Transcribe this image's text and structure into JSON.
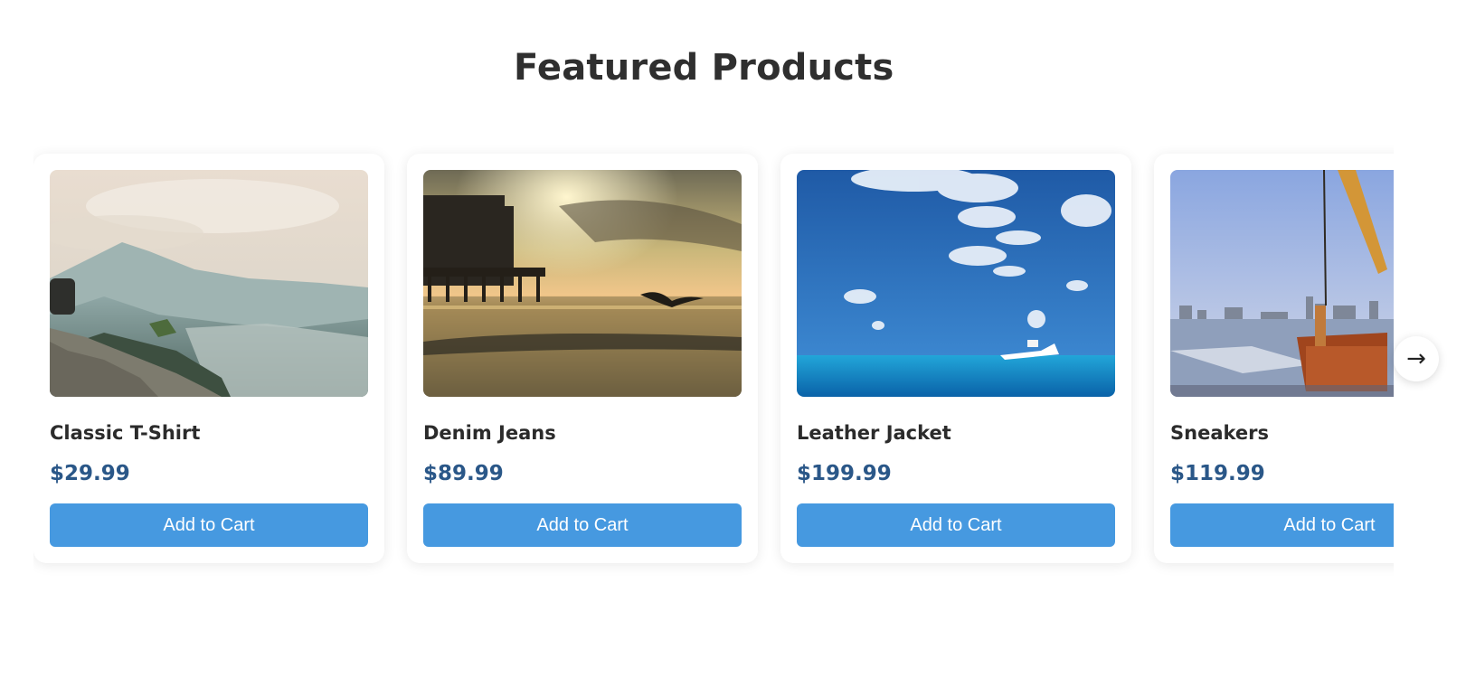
{
  "section": {
    "title": "Featured Products"
  },
  "products": [
    {
      "name": "Classic T-Shirt",
      "price": "$29.99",
      "button": "Add to Cart",
      "image": "mountain-landscape-photo"
    },
    {
      "name": "Denim Jeans",
      "price": "$89.99",
      "button": "Add to Cart",
      "image": "pier-sunset-photo"
    },
    {
      "name": "Leather Jacket",
      "price": "$199.99",
      "button": "Add to Cart",
      "image": "ocean-boat-photo"
    },
    {
      "name": "Sneakers",
      "price": "$119.99",
      "button": "Add to Cart",
      "image": "harbor-ship-photo"
    }
  ],
  "carousel": {
    "next_label": "→",
    "next_icon": "arrow-right-icon"
  },
  "colors": {
    "accent": "#4699e0",
    "price": "#2a5788",
    "title": "#2f2f2f"
  }
}
